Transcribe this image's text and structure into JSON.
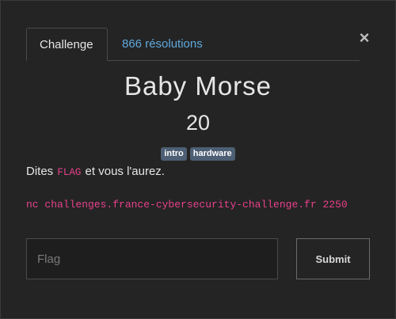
{
  "modal": {
    "tabs": [
      {
        "label": "Challenge"
      },
      {
        "label": "866 résolutions"
      }
    ],
    "title": "Baby Morse",
    "points": "20",
    "tags": [
      "intro",
      "hardware"
    ],
    "description": {
      "before": "Dites",
      "code": "FLAG",
      "after": "et vous l'aurez."
    },
    "command": "nc challenges.france-cybersecurity-challenge.fr 2250",
    "flag_input": {
      "placeholder": "Flag",
      "value": ""
    },
    "submit_label": "Submit",
    "close_symbol": "×"
  }
}
